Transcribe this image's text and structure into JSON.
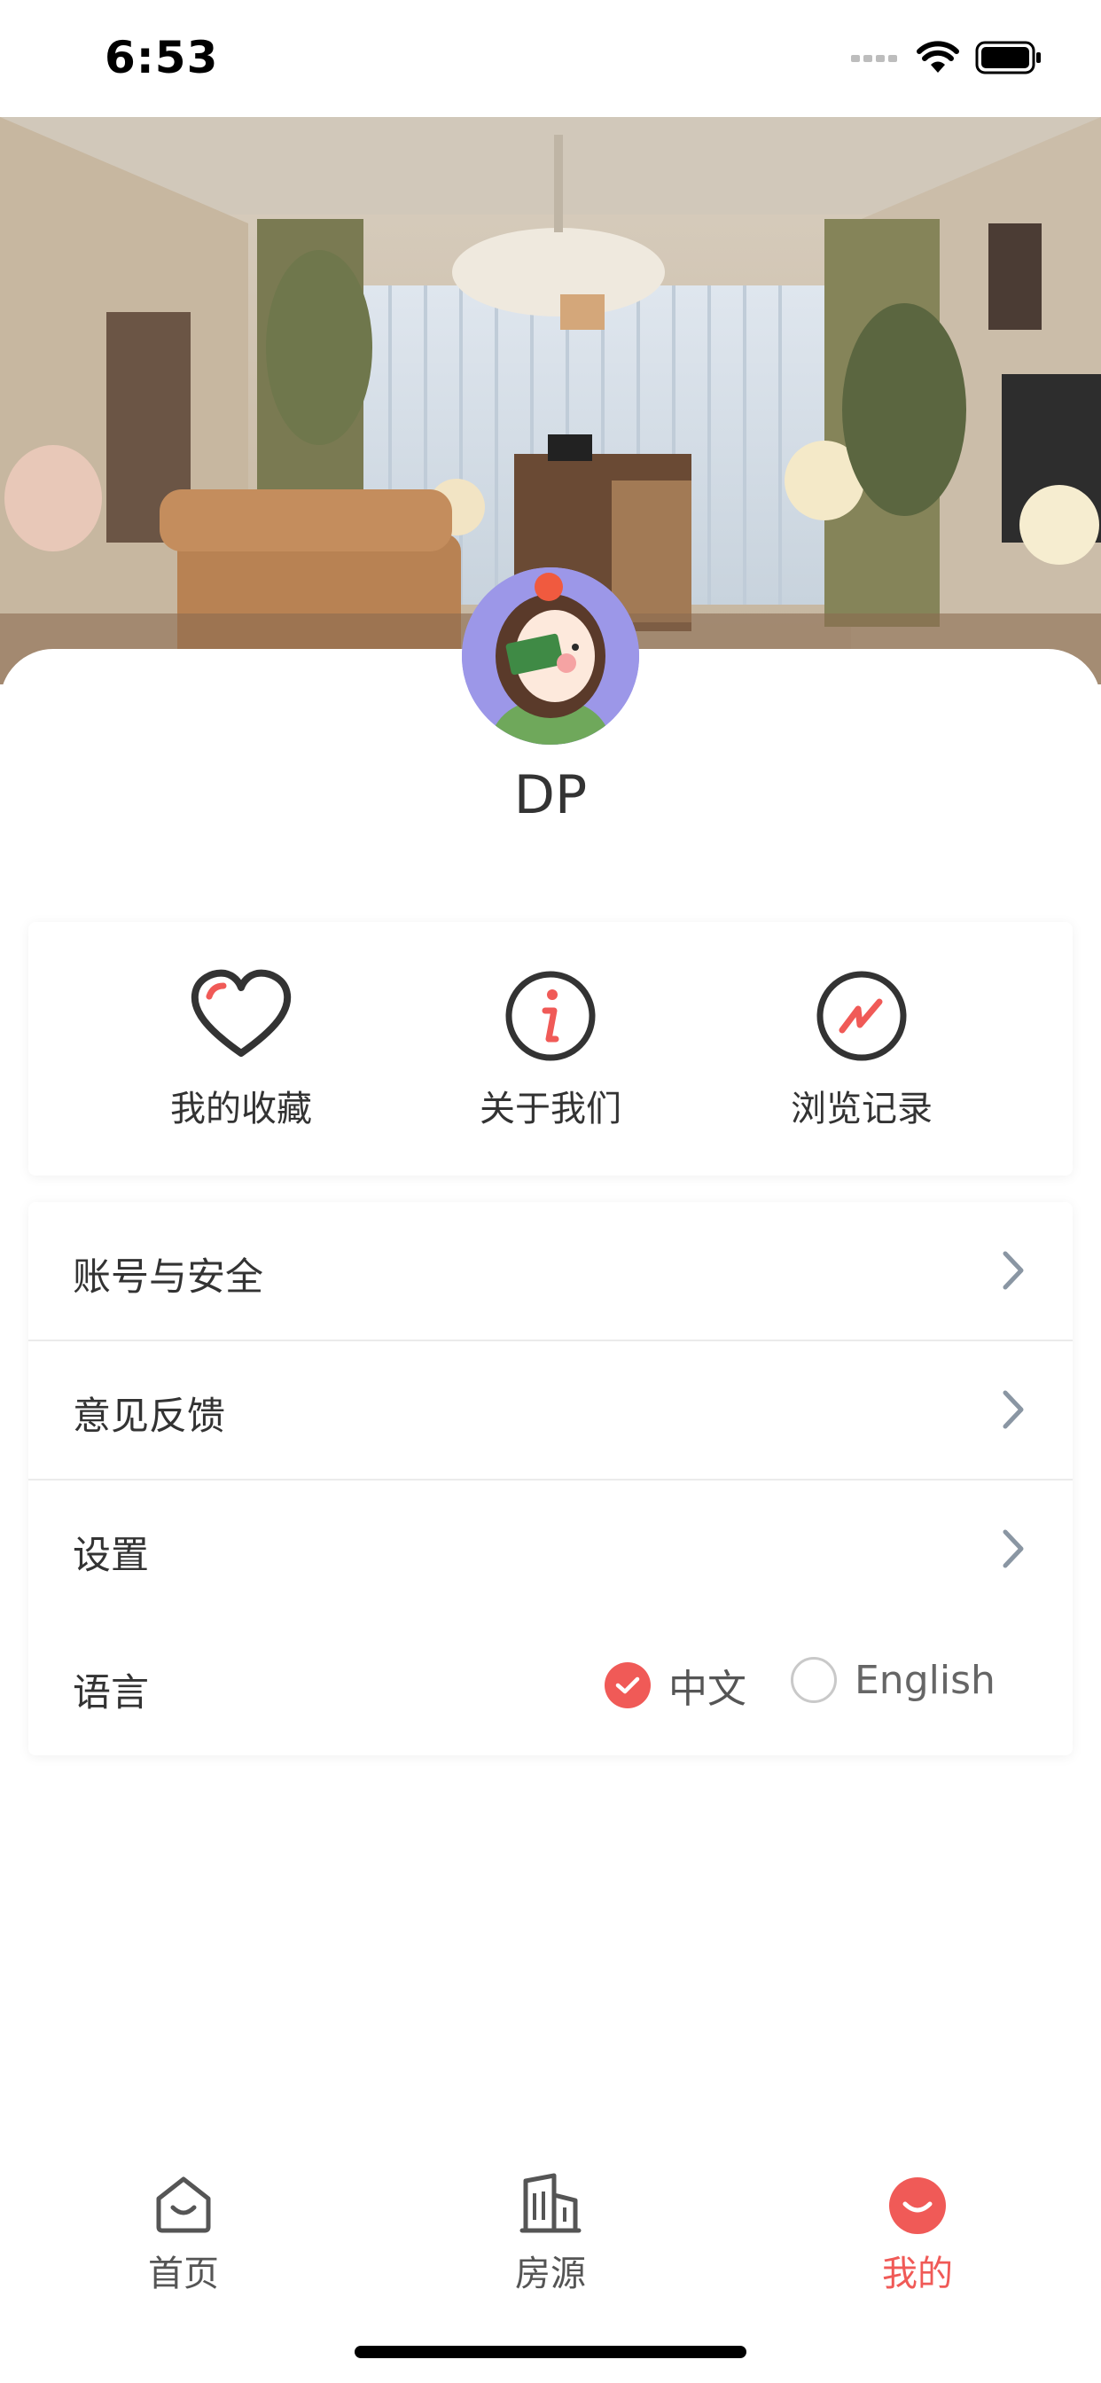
{
  "status_bar": {
    "time": "6:53"
  },
  "profile": {
    "username": "DP"
  },
  "quick_actions": [
    {
      "label": "我的收藏",
      "icon": "heart-icon"
    },
    {
      "label": "关于我们",
      "icon": "info-icon"
    },
    {
      "label": "浏览记录",
      "icon": "history-icon"
    }
  ],
  "menu": [
    {
      "label": "账号与安全"
    },
    {
      "label": "意见反馈"
    },
    {
      "label": "设置"
    }
  ],
  "language": {
    "label": "语言",
    "options": [
      {
        "label": "中文",
        "selected": true
      },
      {
        "label": "English",
        "selected": false
      }
    ]
  },
  "tabs": [
    {
      "label": "首页",
      "icon": "home-icon",
      "active": false
    },
    {
      "label": "房源",
      "icon": "building-icon",
      "active": false
    },
    {
      "label": "我的",
      "icon": "profile-icon",
      "active": true
    }
  ],
  "colors": {
    "accent": "#f05a57",
    "text": "#333333",
    "chevron": "#8a96a3"
  }
}
